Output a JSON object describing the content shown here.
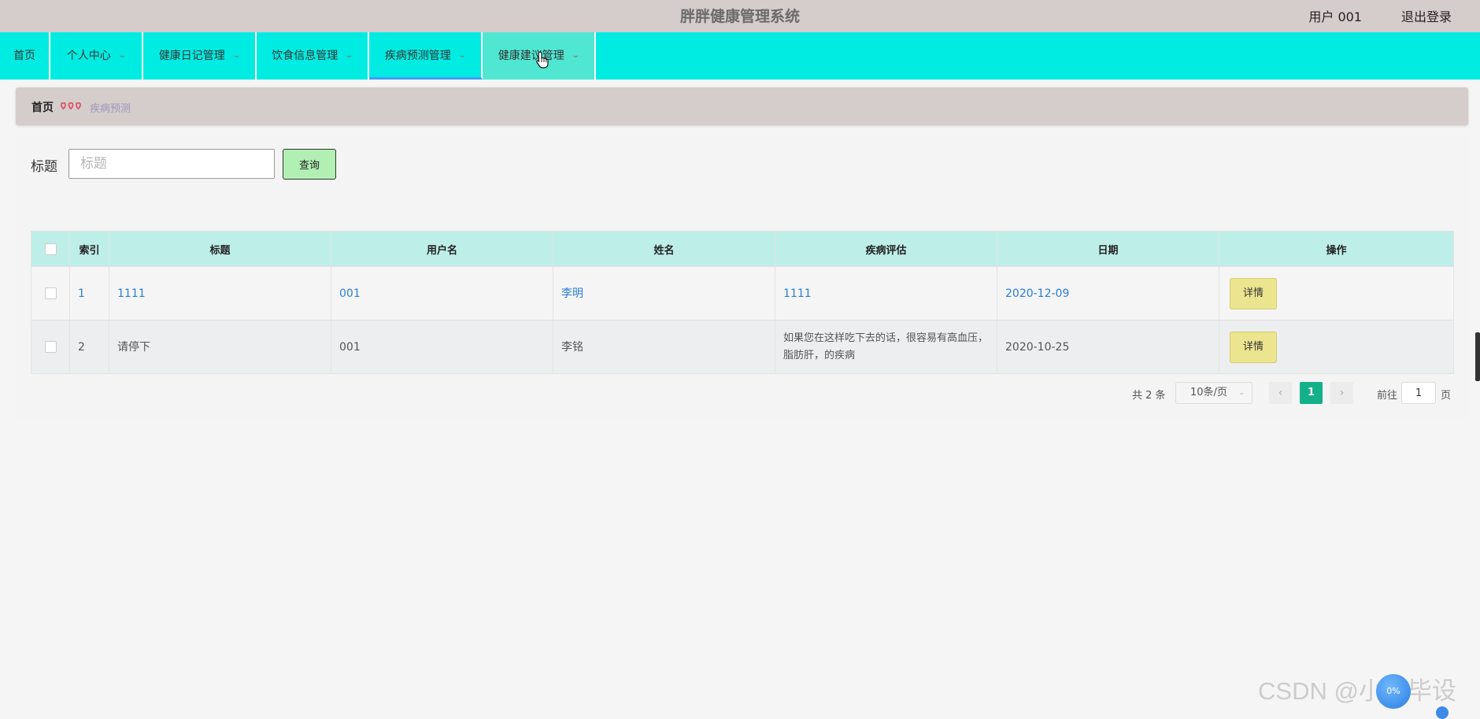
{
  "header": {
    "title": "胖胖健康管理系统",
    "user": "用户 001",
    "logout": "退出登录"
  },
  "nav": {
    "items": [
      {
        "label": "首页"
      },
      {
        "label": "个人中心"
      },
      {
        "label": "健康日记管理"
      },
      {
        "label": "饮食信息管理"
      },
      {
        "label": "疾病预测管理"
      },
      {
        "label": "健康建议管理"
      }
    ],
    "chevron": "⌄"
  },
  "breadcrumb": {
    "home": "首页",
    "current": "疾病预测"
  },
  "search": {
    "label": "标题",
    "placeholder": "标题",
    "value": "",
    "button": "查询"
  },
  "table": {
    "headers": [
      "索引",
      "标题",
      "用户名",
      "姓名",
      "疾病评估",
      "日期",
      "操作"
    ],
    "rows": [
      {
        "index": "1",
        "title": "1111",
        "username": "001",
        "name": "李明",
        "assessment": "1111",
        "date": "2020-12-09",
        "action": "详情"
      },
      {
        "index": "2",
        "title": "请停下",
        "username": "001",
        "name": "李铭",
        "assessment": "如果您在这样吃下去的话，很容易有高血压，脂肪肝，的疾病",
        "date": "2020-10-25",
        "action": "详情"
      }
    ]
  },
  "pagination": {
    "total": "共 2 条",
    "page_size": "10条/页",
    "current_page": "1",
    "goto_label": "前往",
    "goto_value": "1",
    "goto_suffix": "页"
  },
  "watermark": {
    "text": "CSDN @小新毕设",
    "ball_label": "0%"
  },
  "colors": {
    "header_bg": "#d5cccc",
    "nav_bg": "#00ece2",
    "table_header_bg": "#beeee8",
    "query_button": "#b1efb3",
    "detail_button": "#ebe58f",
    "current_page": "#14b08a",
    "link": "#2b7fd6"
  }
}
